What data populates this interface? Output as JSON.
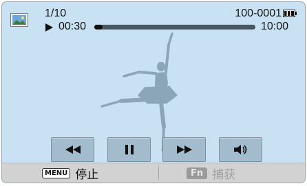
{
  "screen": {
    "counter": "1/10",
    "file_id": "100-0001",
    "elapsed": "00:30",
    "total": "10:00",
    "progress_fraction": 0.05,
    "icons": {
      "thumbnail": "image-thumbnail-icon",
      "battery": "battery-full-icon",
      "play_state": "play-icon"
    }
  },
  "controls": [
    {
      "icon": "rewind-icon"
    },
    {
      "icon": "pause-icon"
    },
    {
      "icon": "fast-forward-icon"
    },
    {
      "icon": "volume-icon"
    }
  ],
  "bottom_bar": {
    "menu_key": "MENU",
    "menu_label": "停止",
    "fn_key": "Fn",
    "fn_label": "捕获"
  },
  "colors": {
    "background": "#c9e2f3",
    "dancer": "#8aa6b8",
    "progress_fill": "#111111",
    "button": "#a3bccd",
    "fn_label_disabled": "#a0a0a0"
  }
}
